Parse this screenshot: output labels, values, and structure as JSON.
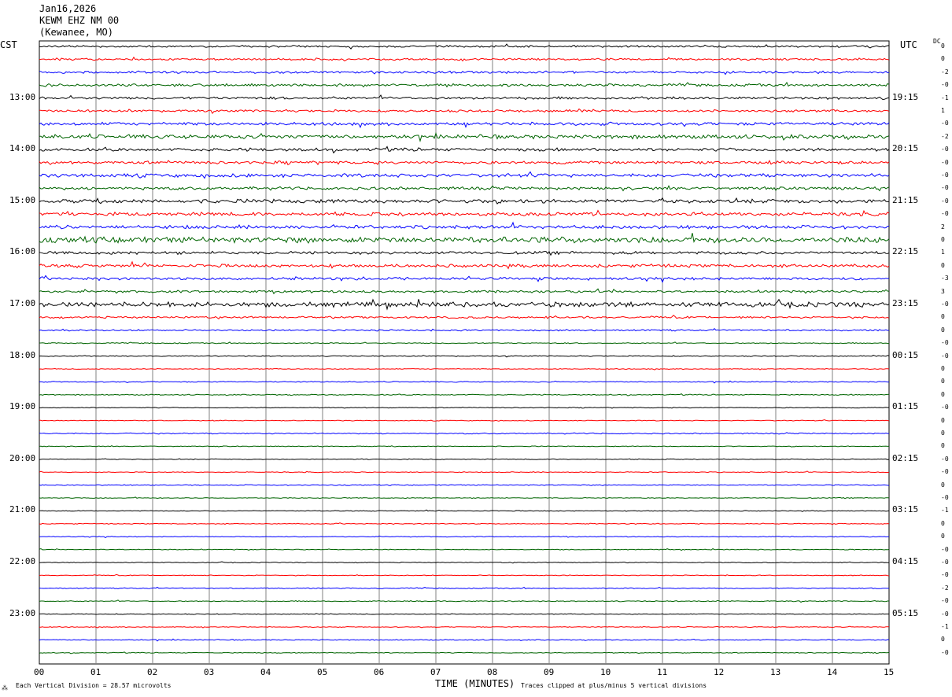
{
  "header": {
    "date": "Jan16,2026",
    "station": "KEWM EHZ NM 00",
    "location": "(Kewanee, MO)"
  },
  "left_timezone": "CST",
  "right_timezone": "UTC",
  "dc_label": "DC",
  "footer": {
    "left_mark": "⁂",
    "scale_text": "Each Vertical Division =   28.57 microvolts",
    "clip_text": "Traces clipped at plus/minus 5 vertical divisions"
  },
  "colors": {
    "palette": [
      "#000000",
      "#ff0000",
      "#0000ff",
      "#006400"
    ],
    "grid": "#808080"
  },
  "chart_data": {
    "type": "line",
    "xlabel": "TIME (MINUTES)",
    "x_ticks": [
      "00",
      "01",
      "02",
      "03",
      "04",
      "05",
      "06",
      "07",
      "08",
      "09",
      "10",
      "11",
      "12",
      "13",
      "14",
      "15"
    ],
    "xlim": [
      0,
      15
    ],
    "left_hour_labels": [
      "13:00",
      "14:00",
      "15:00",
      "16:00",
      "17:00",
      "18:00",
      "19:00",
      "20:00",
      "21:00",
      "22:00",
      "23:00"
    ],
    "right_hour_labels": [
      "19:15",
      "20:15",
      "21:15",
      "22:15",
      "23:15",
      "00:15",
      "01:15",
      "02:15",
      "03:15",
      "04:15",
      "05:15"
    ],
    "traces_per_hour": 4,
    "minutes_per_trace": 15,
    "dc_offsets": [
      "0",
      "0",
      "-2",
      "-0",
      "-1",
      "1",
      "-0",
      "-2",
      "-0",
      "-0",
      "-0",
      "-0",
      "-0",
      "-0",
      "2",
      "0",
      "1",
      "0",
      "-3",
      "3",
      "-0",
      "0",
      "0",
      "-0",
      "-0",
      "0",
      "0",
      "0",
      "-0",
      "0",
      "0",
      "0",
      "-0",
      "-0",
      "0",
      "-0",
      "-1",
      "0",
      "0",
      "-0",
      "-0",
      "-0",
      "-2",
      "-0",
      "-0",
      "-1",
      "0",
      "-0"
    ],
    "amplitude_levels": [
      1.0,
      1.0,
      1.2,
      1.3,
      1.3,
      1.2,
      1.6,
      2.0,
      1.6,
      1.5,
      1.8,
      1.5,
      2.0,
      1.8,
      1.8,
      3.0,
      1.5,
      1.6,
      1.4,
      1.2,
      2.5,
      1.0,
      0.8,
      0.5,
      0.5,
      0.4,
      0.5,
      0.5,
      0.4,
      0.4,
      0.6,
      0.4,
      0.4,
      0.4,
      0.5,
      0.4,
      0.4,
      0.4,
      0.4,
      0.4,
      0.4,
      0.4,
      0.5,
      0.5,
      0.4,
      0.4,
      0.5,
      0.4
    ]
  }
}
